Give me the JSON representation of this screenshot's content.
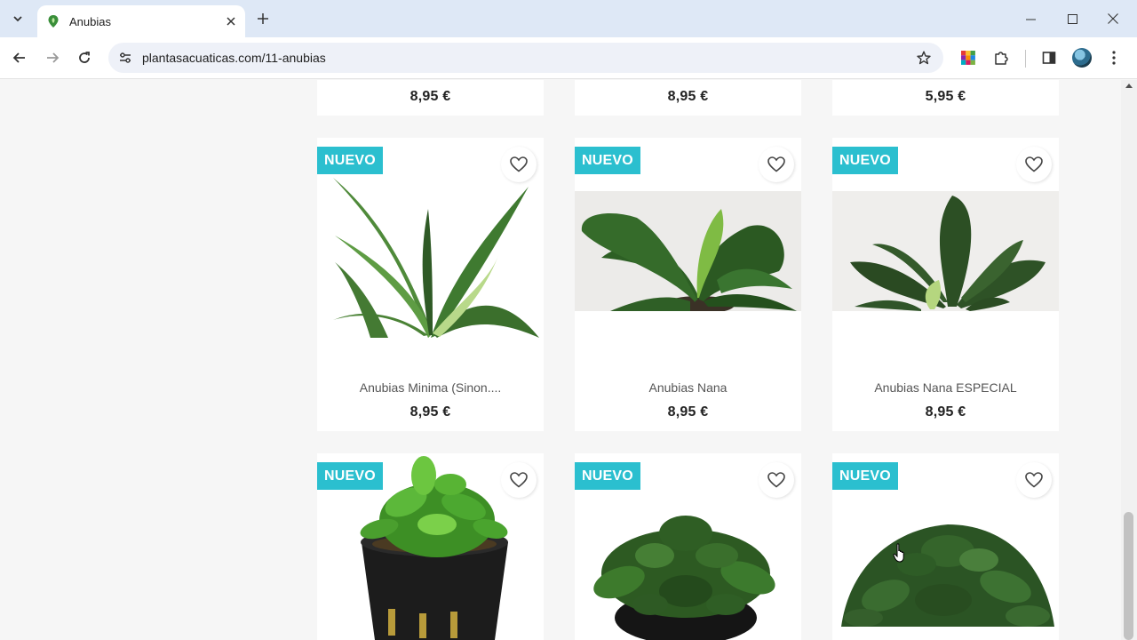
{
  "browser": {
    "tab_title": "Anubias",
    "url": "plantasacuaticas.com/11-anubias"
  },
  "products_top": [
    {
      "price": "8,95 €"
    },
    {
      "price": "8,95 €"
    },
    {
      "price": "5,95 €"
    }
  ],
  "products_mid": [
    {
      "badge": "NUEVO",
      "name": "Anubias Minima (Sinon....",
      "price": "8,95 €"
    },
    {
      "badge": "NUEVO",
      "name": "Anubias Nana",
      "price": "8,95 €"
    },
    {
      "badge": "NUEVO",
      "name": "Anubias Nana ESPECIAL",
      "price": "8,95 €"
    }
  ],
  "products_bottom": [
    {
      "badge": "NUEVO"
    },
    {
      "badge": "NUEVO"
    },
    {
      "badge": "NUEVO"
    }
  ],
  "colors": {
    "badge": "#2bbfcf",
    "leaf_dark": "#2f5a26",
    "leaf_light": "#6fbf3a"
  },
  "icons": {
    "wishlist": "heart-icon",
    "favicon": "leaf-pin-icon"
  }
}
